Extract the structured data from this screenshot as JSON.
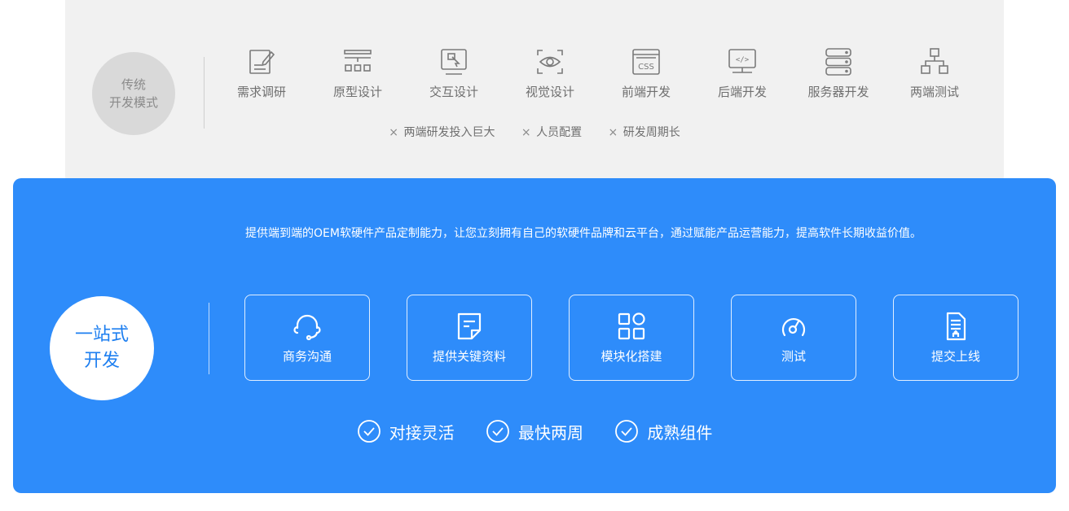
{
  "traditional": {
    "badge_line1": "传统",
    "badge_line2": "开发模式",
    "steps": [
      {
        "label": "需求调研",
        "icon": "edit-doc-icon"
      },
      {
        "label": "原型设计",
        "icon": "layout-icon"
      },
      {
        "label": "交互设计",
        "icon": "monitor-touch-icon"
      },
      {
        "label": "视觉设计",
        "icon": "eye-icon"
      },
      {
        "label": "前端开发",
        "icon": "css-icon"
      },
      {
        "label": "后端开发",
        "icon": "code-icon"
      },
      {
        "label": "服务器开发",
        "icon": "server-icon"
      },
      {
        "label": "两端测试",
        "icon": "network-icon"
      }
    ],
    "cons": [
      "两端研发投入巨大",
      "人员配置",
      "研发周期长"
    ],
    "cons_mark": "×"
  },
  "onestop": {
    "badge_line1": "一站式",
    "badge_line2": "开发",
    "description": "提供端到端的OEM软硬件产品定制能力，让您立刻拥有自己的软硬件品牌和云平台，通过赋能产品运营能力，提高软件长期收益价值。",
    "cards": [
      {
        "label": "商务沟通",
        "icon": "headset-icon"
      },
      {
        "label": "提供关键资料",
        "icon": "document-icon"
      },
      {
        "label": "模块化搭建",
        "icon": "modules-icon"
      },
      {
        "label": "测试",
        "icon": "gauge-icon"
      },
      {
        "label": "提交上线",
        "icon": "upload-doc-icon"
      }
    ],
    "features": [
      "对接灵活",
      "最快两周",
      "成熟组件"
    ]
  },
  "colors": {
    "accent": "#2e8cfa",
    "panel_gray": "#f1f1f1",
    "badge_gray": "#d9d9d9"
  }
}
